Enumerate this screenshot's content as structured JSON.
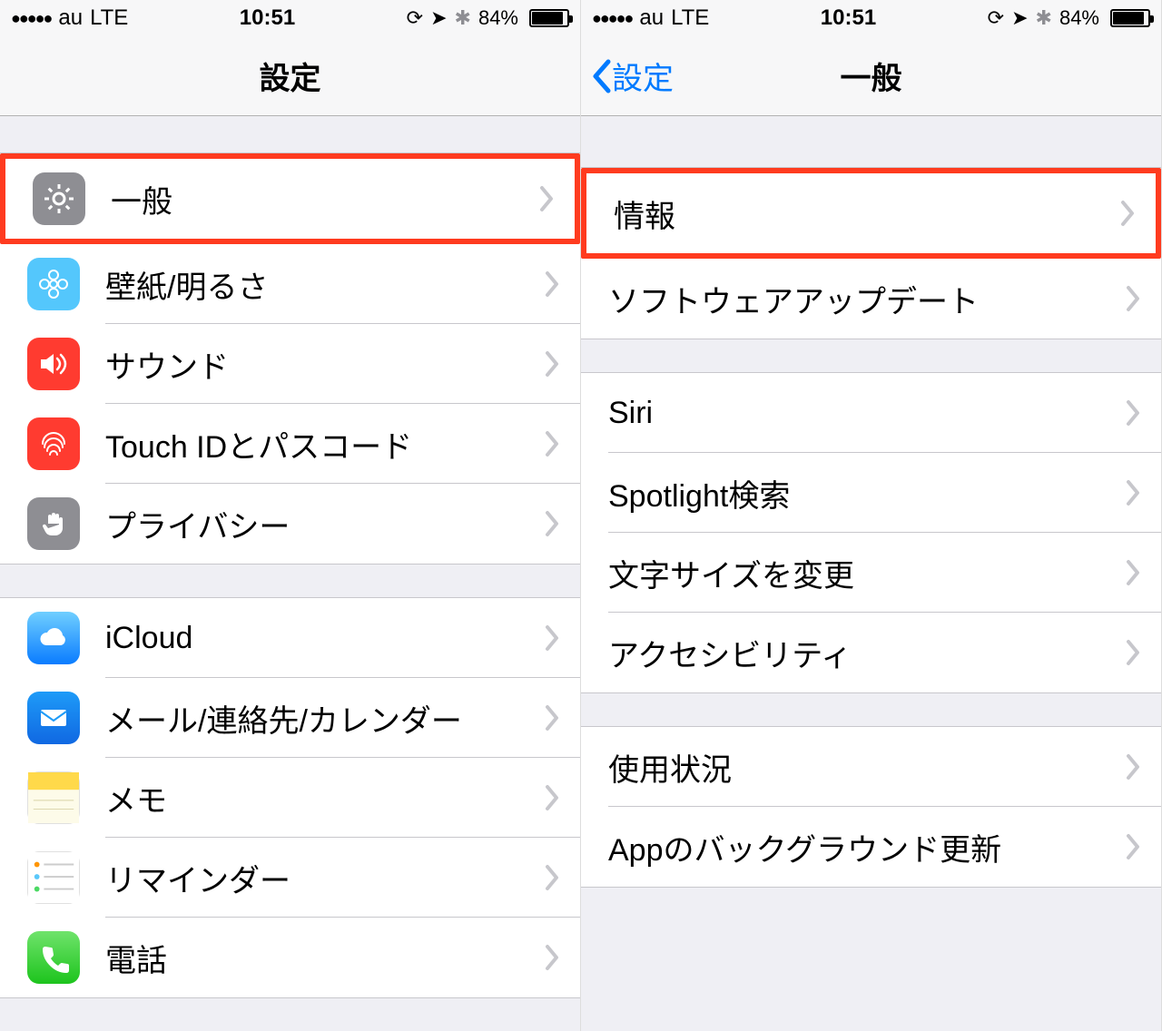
{
  "status": {
    "carrier": "au",
    "network": "LTE",
    "time": "10:51",
    "battery_pct": "84%",
    "battery_fill_pct": 84
  },
  "left": {
    "title": "設定",
    "groups": [
      {
        "rows": [
          {
            "label": "一般",
            "icon": "gear",
            "icon_bg": "bg-gray",
            "highlight": true
          },
          {
            "label": "壁紙/明るさ",
            "icon": "flower",
            "icon_bg": "bg-cyan"
          },
          {
            "label": "サウンド",
            "icon": "speaker",
            "icon_bg": "bg-red"
          },
          {
            "label": "Touch IDとパスコード",
            "icon": "fingerprint",
            "icon_bg": "bg-red"
          },
          {
            "label": "プライバシー",
            "icon": "hand",
            "icon_bg": "bg-gray"
          }
        ]
      },
      {
        "rows": [
          {
            "label": "iCloud",
            "icon": "cloud",
            "icon_bg": "bg-bluegrad"
          },
          {
            "label": "メール/連絡先/カレンダー",
            "icon": "mail",
            "icon_bg": "bg-bluemail"
          },
          {
            "label": "メモ",
            "icon": "notes",
            "icon_bg": "bg-white"
          },
          {
            "label": "リマインダー",
            "icon": "reminders",
            "icon_bg": "bg-white"
          },
          {
            "label": "電話",
            "icon": "phone",
            "icon_bg": "bg-green"
          }
        ]
      }
    ]
  },
  "right": {
    "back_label": "設定",
    "title": "一般",
    "groups": [
      {
        "rows": [
          {
            "label": "情報",
            "highlight": true
          },
          {
            "label": "ソフトウェアアップデート"
          }
        ]
      },
      {
        "rows": [
          {
            "label": "Siri"
          },
          {
            "label": "Spotlight検索"
          },
          {
            "label": "文字サイズを変更"
          },
          {
            "label": "アクセシビリティ"
          }
        ]
      },
      {
        "rows": [
          {
            "label": "使用状況"
          },
          {
            "label": "Appのバックグラウンド更新"
          }
        ]
      }
    ]
  }
}
